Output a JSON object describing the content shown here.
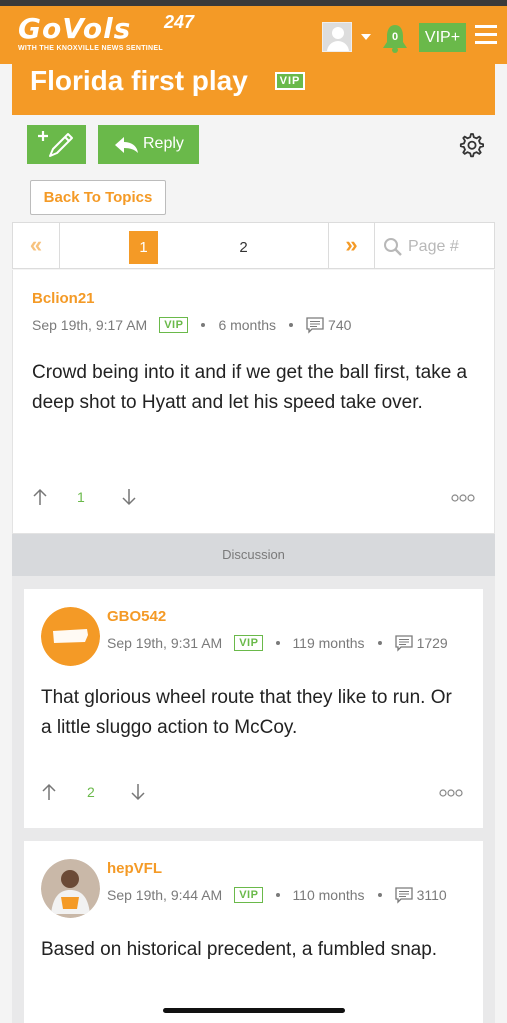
{
  "header": {
    "logo_main": "GoVols",
    "logo_super": "247",
    "logo_sub": "WITH THE KNOXVILLE NEWS SENTINEL",
    "notification_count": "0",
    "vip_button": "VIP+",
    "accent_color": "#f49a26",
    "green_color": "#6ab94a"
  },
  "topic": {
    "title": "Florida first play",
    "badge": "VIP"
  },
  "toolbar": {
    "reply_label": "Reply",
    "back_label": "Back To Topics"
  },
  "pagination": {
    "prev": "«",
    "next": "»",
    "pages": [
      "1",
      "2"
    ],
    "current": "1",
    "placeholder": "Page #"
  },
  "post": {
    "author": "Bclion21",
    "date": "Sep 19th, 9:17 AM",
    "badge": "VIP",
    "tenure": "6 months",
    "post_count": "740",
    "body": "Crowd being into it and if we get the ball first, take a deep shot to Hyatt and let his speed take over.",
    "score": "1"
  },
  "discussion_label": "Discussion",
  "replies": [
    {
      "author": "GBO542",
      "date": "Sep 19th, 9:31 AM",
      "badge": "VIP",
      "tenure": "119 months",
      "post_count": "1729",
      "body": "That glorious wheel route that they like to run. Or a little sluggo action to McCoy.",
      "score": "2"
    },
    {
      "author": "hepVFL",
      "date": "Sep 19th, 9:44 AM",
      "badge": "VIP",
      "tenure": "110 months",
      "post_count": "3110",
      "body": "Based on historical precedent, a fumbled snap."
    }
  ]
}
